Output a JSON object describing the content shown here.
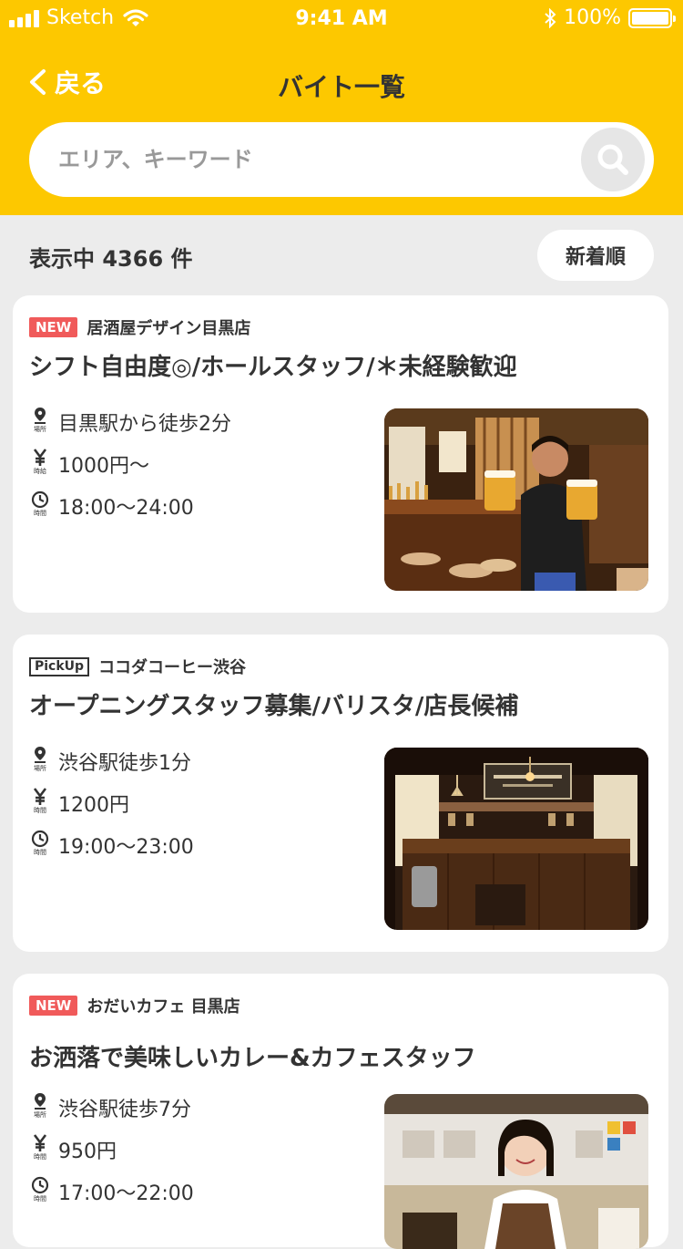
{
  "status": {
    "carrier": "Sketch",
    "time": "9:41 AM",
    "battery": "100%"
  },
  "nav": {
    "back_label": "戻る",
    "title": "バイト一覧"
  },
  "search": {
    "placeholder": "エリア、キーワード"
  },
  "list": {
    "count_text": "表示中 4366 件",
    "sort_label": "新着順"
  },
  "jobs": [
    {
      "badge": "NEW",
      "shop": "居酒屋デザイン目黒店",
      "title": "シフト自由度◎/ホールスタッフ/＊未経験歓迎",
      "access": "目黒駅から徒歩2分",
      "wage": "1000円〜",
      "hours": "18:00〜24:00"
    },
    {
      "badge": "PickUp",
      "shop": "ココダコーヒー渋谷",
      "title": "オープニングスタッフ募集/バリスタ/店長候補",
      "access": "渋谷駅徒歩1分",
      "wage": "1200円",
      "hours": "19:00〜23:00"
    },
    {
      "badge": "NEW",
      "shop": "おだいカフェ 目黒店",
      "title": "お洒落で美味しいカレー&カフェスタッフ",
      "access": "渋谷駅徒歩7分",
      "wage": "950円",
      "hours": "17:00〜22:00"
    }
  ],
  "icon_captions": {
    "place": "場所",
    "wage": "時給",
    "time": "時間"
  },
  "colors": {
    "header": "#fdc800",
    "badge_new": "#f05a5a",
    "background": "#ececec"
  }
}
